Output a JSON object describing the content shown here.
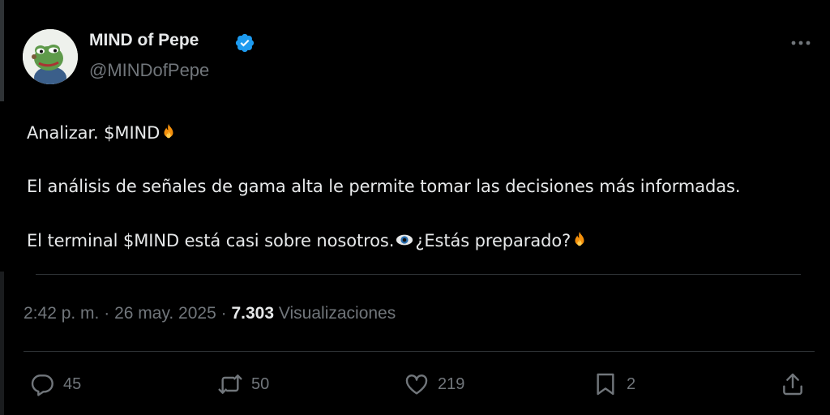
{
  "author": {
    "display_name": "MIND of Pepe",
    "handle": "@MINDofPepe"
  },
  "post": {
    "line1": "Analizar. $MIND",
    "line2": "El análisis de señales de gama alta le permite tomar las decisiones más informadas.",
    "line3_before_emoji": "El terminal $MIND está casi sobre nosotros.",
    "line3_after_emoji": "¿Estás preparado?"
  },
  "meta": {
    "time": "2:42 p. m.",
    "separator": "·",
    "date": "26 may. 2025",
    "views_count": "7.303",
    "views_label": "Visualizaciones"
  },
  "actions": {
    "reply_count": "45",
    "repost_count": "50",
    "like_count": "219",
    "bookmark_count": "2"
  },
  "icons": {
    "verified": "verified-badge-icon",
    "more": "more-horizontal-icon",
    "reply": "reply-icon",
    "repost": "repost-icon",
    "like": "heart-icon",
    "bookmark": "bookmark-icon",
    "share": "share-icon",
    "fire": "fire-emoji",
    "eye": "eye-emoji"
  },
  "colors": {
    "background": "#000000",
    "text_primary": "#e7e9ea",
    "text_secondary": "#71767b",
    "verified_blue": "#1d9bf0",
    "divider": "#2f3336"
  }
}
